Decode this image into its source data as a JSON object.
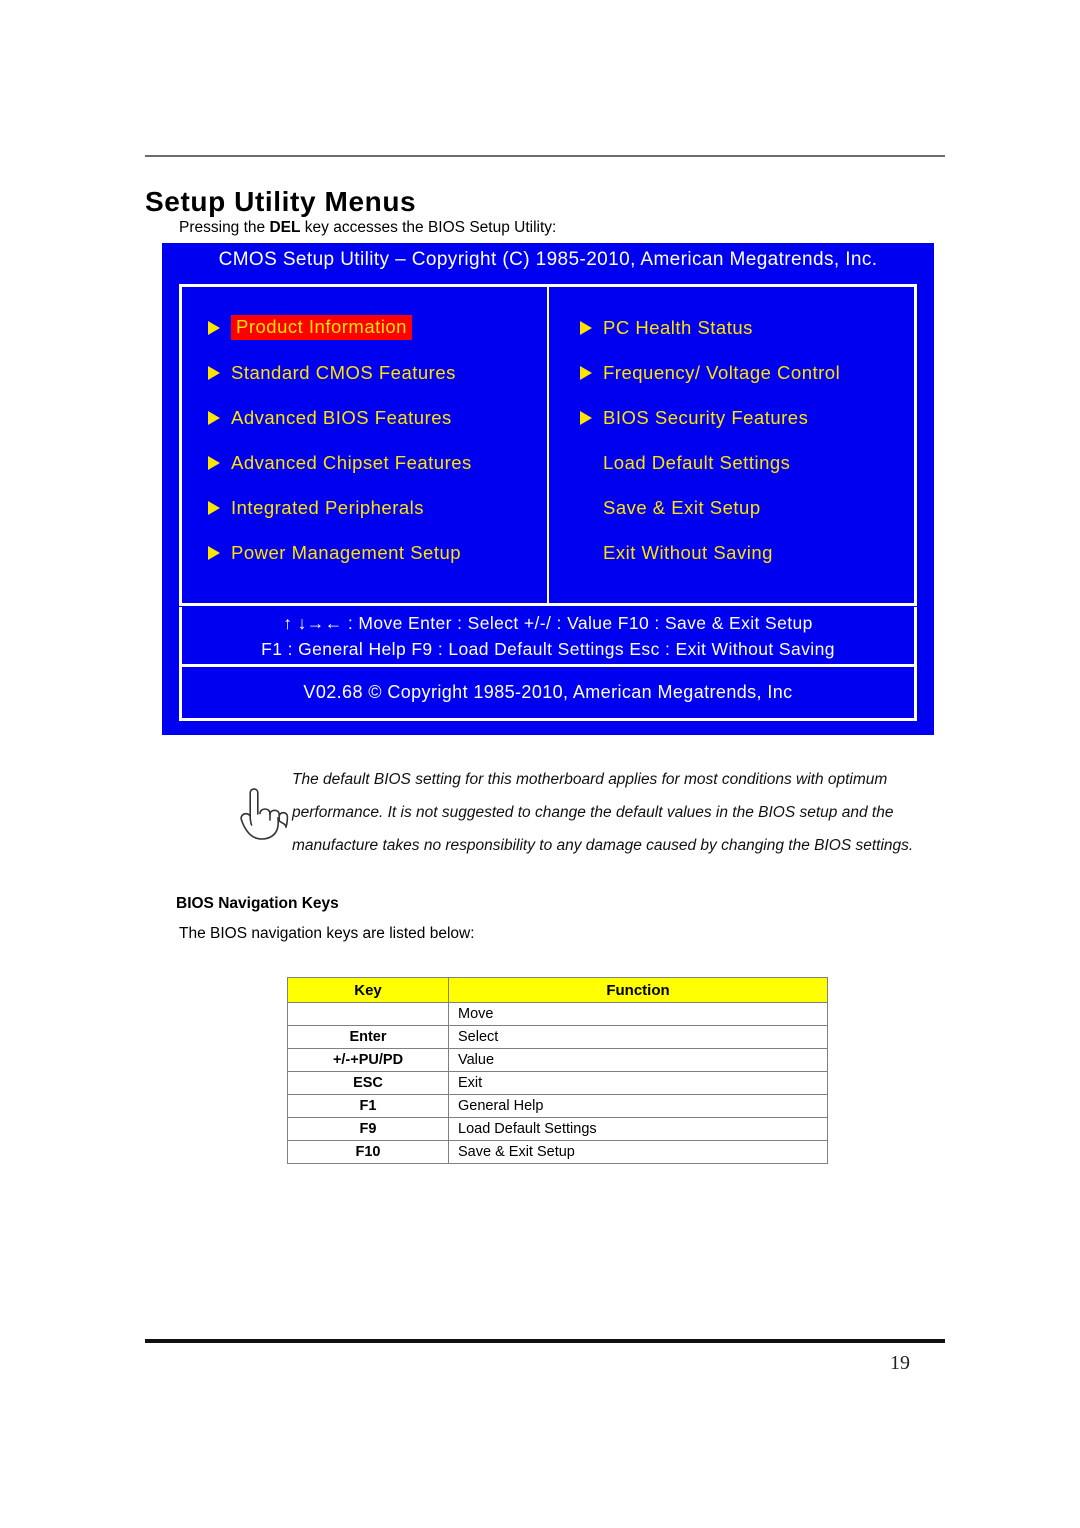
{
  "page": {
    "number": "19"
  },
  "section": {
    "title": "Setup Utility Menus",
    "intro_before": "Pressing the ",
    "intro_key": "DEL",
    "intro_after": " key accesses the BIOS Setup Utility:"
  },
  "bios": {
    "titlebar": "CMOS Setup Utility – Copyright (C) 1985-2010, American Megatrends, Inc.",
    "copyright": "V02.68 © Copyright 1985-2010, American Megatrends, Inc",
    "colors": {
      "background": "#0000f0",
      "menu_text": "#ffe400",
      "title_text": "#ffffff",
      "selected_background": "#ff0000",
      "selected_text": "#ffe400",
      "border": "#ffffff"
    },
    "left_menu": [
      {
        "label": "Product Information",
        "has_arrow": true,
        "selected": true
      },
      {
        "label": "Standard CMOS Features",
        "has_arrow": true,
        "selected": false
      },
      {
        "label": "Advanced BIOS Features",
        "has_arrow": true,
        "selected": false
      },
      {
        "label": "Advanced Chipset Features",
        "has_arrow": true,
        "selected": false
      },
      {
        "label": "Integrated Peripherals",
        "has_arrow": true,
        "selected": false
      },
      {
        "label": "Power Management Setup",
        "has_arrow": true,
        "selected": false
      }
    ],
    "right_menu": [
      {
        "label": "PC Health Status",
        "has_arrow": true,
        "selected": false
      },
      {
        "label": "Frequency/ Voltage Control",
        "has_arrow": true,
        "selected": false
      },
      {
        "label": "BIOS Security Features",
        "has_arrow": true,
        "selected": false
      },
      {
        "label": "Load Default Settings",
        "has_arrow": false,
        "selected": false
      },
      {
        "label": "Save & Exit Setup",
        "has_arrow": false,
        "selected": false
      },
      {
        "label": "Exit Without Saving",
        "has_arrow": false,
        "selected": false
      }
    ],
    "help_lines": [
      "↑ ↓→← : Move   Enter : Select   +/-/ : Value   F10 : Save & Exit Setup",
      "F1 : General Help      F9 : Load Default Settings   Esc :  Exit Without Saving"
    ]
  },
  "note": {
    "lines": [
      "The default BIOS setting for this motherboard applies for most conditions with optimum",
      "performance. It is not suggested to change the default values in the BIOS setup and the",
      "manufacture takes no responsibility to any damage caused by changing the BIOS settings."
    ]
  },
  "nav_section": {
    "heading": "BIOS Navigation Keys",
    "subtitle": "The BIOS navigation keys are listed below:",
    "table": {
      "headers": [
        "Key",
        "Function"
      ],
      "rows": [
        {
          "key": "",
          "function": "Move"
        },
        {
          "key": "Enter",
          "function": "Select"
        },
        {
          "key": "+/-+PU/PD",
          "function": "Value"
        },
        {
          "key": "ESC",
          "function": "Exit"
        },
        {
          "key": "F1",
          "function": "General Help"
        },
        {
          "key": "F9",
          "function": "Load Default Settings"
        },
        {
          "key": "F10",
          "function": "Save & Exit Setup"
        }
      ]
    }
  }
}
